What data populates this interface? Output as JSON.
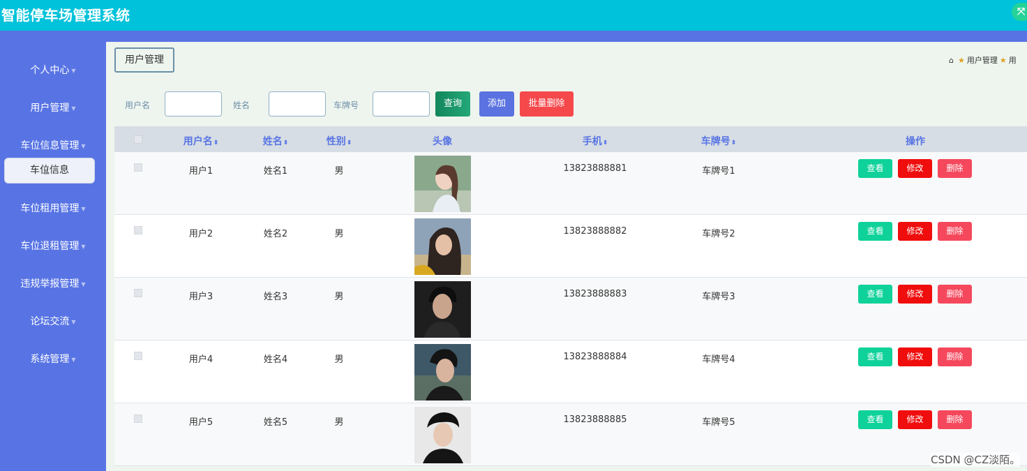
{
  "app": {
    "title": "智能停车场管理系统"
  },
  "sidebar": {
    "items": [
      {
        "label": "个人中心"
      },
      {
        "label": "用户管理"
      },
      {
        "label": "车位信息管理"
      },
      {
        "label": "车位租用管理"
      },
      {
        "label": "车位退租管理"
      },
      {
        "label": "违规举报管理"
      },
      {
        "label": "论坛交流"
      },
      {
        "label": "系统管理"
      }
    ],
    "submenu_active": "车位信息"
  },
  "tab": {
    "label": "用户管理"
  },
  "breadcrumb": {
    "items": [
      "用户管理",
      "用"
    ]
  },
  "filters": {
    "username_label": "用户名",
    "name_label": "姓名",
    "plate_label": "车牌号",
    "query_label": "查询",
    "add_label": "添加",
    "batch_delete_label": "批量删除"
  },
  "table": {
    "headers": {
      "username": "用户名",
      "name": "姓名",
      "gender": "性别",
      "avatar": "头像",
      "phone": "手机",
      "plate": "车牌号",
      "actions": "操作"
    },
    "actions": {
      "view": "查看",
      "edit": "修改",
      "delete": "删除"
    },
    "rows": [
      {
        "username": "用户1",
        "name": "姓名1",
        "gender": "男",
        "phone": "13823888881",
        "plate": "车牌号1"
      },
      {
        "username": "用户2",
        "name": "姓名2",
        "gender": "男",
        "phone": "13823888882",
        "plate": "车牌号2"
      },
      {
        "username": "用户3",
        "name": "姓名3",
        "gender": "男",
        "phone": "13823888883",
        "plate": "车牌号3"
      },
      {
        "username": "用户4",
        "name": "姓名4",
        "gender": "男",
        "phone": "13823888884",
        "plate": "车牌号4"
      },
      {
        "username": "用户5",
        "name": "姓名5",
        "gender": "男",
        "phone": "13823888885",
        "plate": "车牌号5"
      }
    ]
  },
  "watermark": "CSDN @CZ淡陌。",
  "colors": {
    "topbar": "#00c2da",
    "sidebar": "#5874e4",
    "view": "#0ed29a",
    "edit": "#f00d0d",
    "delete": "#f5485c"
  }
}
